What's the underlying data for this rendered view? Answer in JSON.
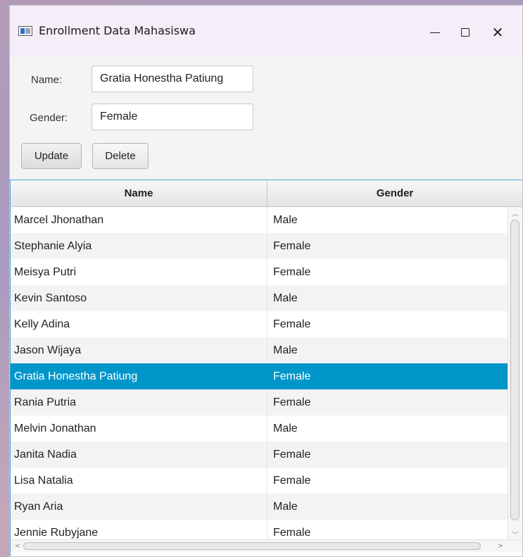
{
  "window": {
    "title": "Enrollment Data Mahasiswa",
    "icon": "app-window-icon",
    "controls": [
      "minimize-icon",
      "maximize-icon",
      "close-icon"
    ]
  },
  "form": {
    "name_label": "Name:",
    "name_value": "Gratia Honestha Patiung",
    "gender_label": "Gender:",
    "gender_value": "Female",
    "update_label": "Update",
    "delete_label": "Delete"
  },
  "table": {
    "columns": [
      "Name",
      "Gender"
    ],
    "selected_index": 6,
    "rows": [
      {
        "name": "Marcel Jhonathan",
        "gender": "Male"
      },
      {
        "name": "Stephanie Alyia",
        "gender": "Female"
      },
      {
        "name": "Meisya Putri",
        "gender": "Female"
      },
      {
        "name": "Kevin Santoso",
        "gender": "Male"
      },
      {
        "name": "Kelly Adina",
        "gender": "Female"
      },
      {
        "name": "Jason Wijaya",
        "gender": "Male"
      },
      {
        "name": "Gratia Honestha Patiung",
        "gender": "Female"
      },
      {
        "name": "Rania Putria",
        "gender": "Female"
      },
      {
        "name": "Melvin Jonathan",
        "gender": "Male"
      },
      {
        "name": "Janita Nadia",
        "gender": "Female"
      },
      {
        "name": "Lisa Natalia",
        "gender": "Female"
      },
      {
        "name": "Ryan Aria",
        "gender": "Male"
      },
      {
        "name": "Jennie Rubyjane",
        "gender": "Female"
      }
    ]
  },
  "colors": {
    "selection": "#0096c9",
    "table_border": "#47a3d6"
  }
}
